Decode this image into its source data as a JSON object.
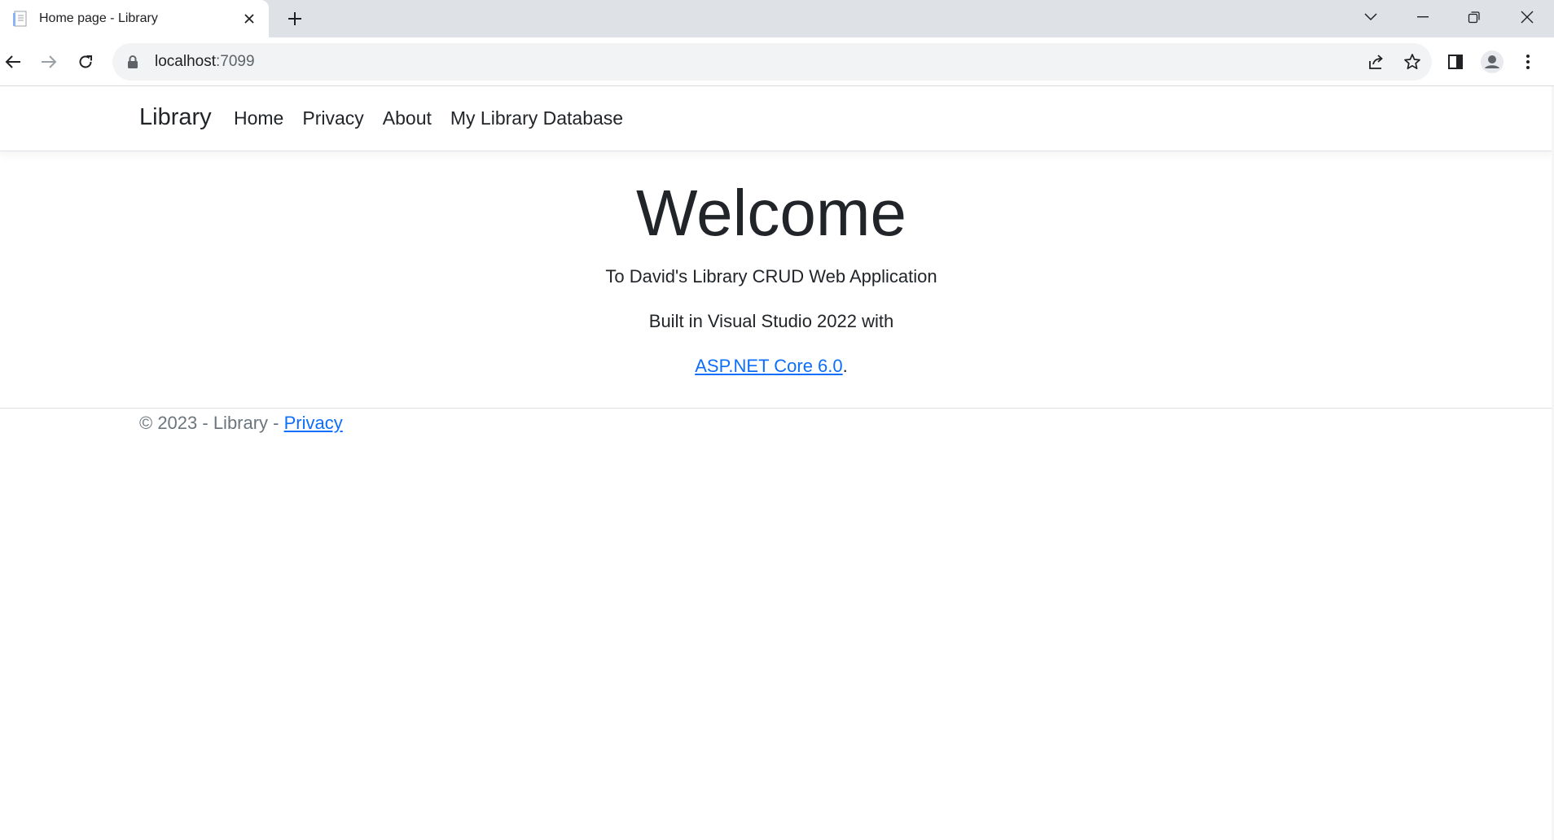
{
  "browser": {
    "tab_title": "Home page - Library",
    "url_host": "localhost",
    "url_port": ":7099",
    "icons": {
      "favicon": "document-icon",
      "close": "close-icon",
      "new_tab": "plus-icon",
      "tab_search": "chevron-down-icon",
      "minimize": "minimize-icon",
      "restore": "restore-icon",
      "close_window": "close-icon",
      "back": "back-arrow-icon",
      "forward": "forward-arrow-icon",
      "reload": "reload-icon",
      "lock": "lock-icon",
      "share": "share-icon",
      "bookmark": "star-icon",
      "side_panel": "side-panel-icon",
      "profile": "profile-icon",
      "menu": "kebab-menu-icon"
    }
  },
  "navbar": {
    "brand": "Library",
    "links": [
      {
        "label": "Home"
      },
      {
        "label": "Privacy"
      },
      {
        "label": "About"
      },
      {
        "label": "My Library Database"
      }
    ]
  },
  "hero": {
    "heading": "Welcome",
    "line1": "To David's Library CRUD Web Application",
    "line2": "Built in Visual Studio 2022 with",
    "link_text": "ASP.NET Core 6.0",
    "link_suffix": "."
  },
  "footer": {
    "prefix": "© 2023 - Library - ",
    "privacy_link": "Privacy"
  },
  "colors": {
    "link": "#0d6efd",
    "tabstrip": "#dee1e6",
    "omnibox": "#f1f3f4",
    "text": "#212529",
    "muted": "#6c757d"
  }
}
